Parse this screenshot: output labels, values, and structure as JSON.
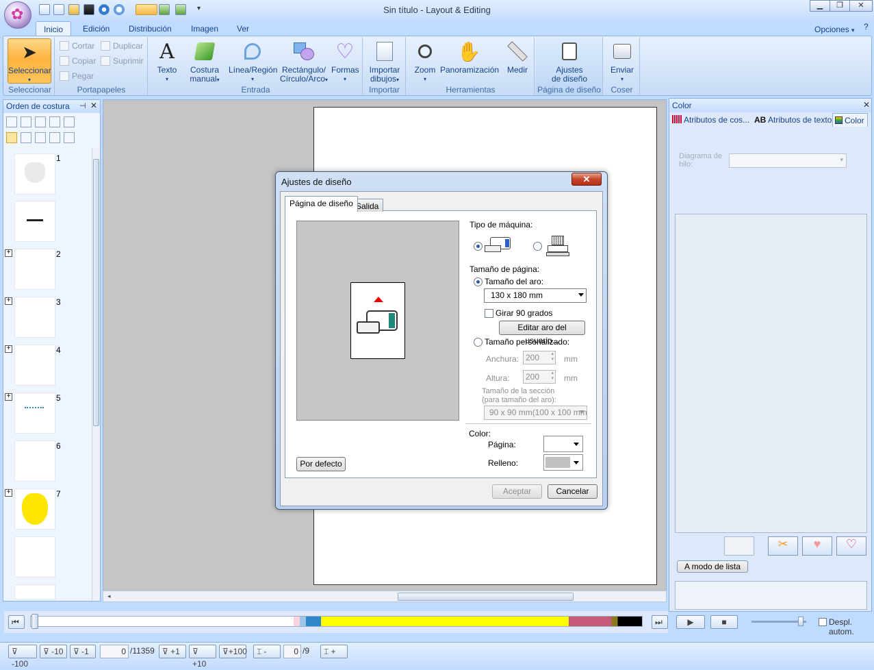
{
  "window": {
    "title": "Sin título - Layout & Editing",
    "minimize": "▁",
    "restore": "❐",
    "close": "✕"
  },
  "ribbon_tabs": [
    "Inicio",
    "Edición",
    "Distribución",
    "Imagen",
    "Ver"
  ],
  "options_label": "Opciones",
  "ribbon": {
    "seleccionar": {
      "label": "Seleccionar",
      "group": "Seleccionar"
    },
    "clipboard": {
      "cortar": "Cortar",
      "copiar": "Copiar",
      "pegar": "Pegar",
      "duplicar": "Duplicar",
      "suprimir": "Suprimir",
      "group": "Portapapeles"
    },
    "entrada": {
      "texto": "Texto",
      "costura_manual_1": "Costura",
      "costura_manual_2": "manual",
      "linea": "Línea/Región",
      "rect_1": "Rectángulo/",
      "rect_2": "Círculo/Arco",
      "formas": "Formas",
      "group": "Entrada"
    },
    "importar": {
      "label_1": "Importar",
      "label_2": "dibujos",
      "group": "Importar"
    },
    "herramientas": {
      "zoom": "Zoom",
      "pan": "Panoramización",
      "medir": "Medir",
      "group": "Herramientas"
    },
    "pagina": {
      "label_1": "Ajustes",
      "label_2": "de diseño",
      "group": "Página de diseño"
    },
    "coser": {
      "label": "Enviar",
      "group": "Coser"
    }
  },
  "left_panel": {
    "title": "Orden de costura",
    "numbers": [
      "1",
      "2",
      "3",
      "4",
      "5",
      "6",
      "7"
    ]
  },
  "right_panel": {
    "title": "Color",
    "tabs": [
      "Atributos de cos...",
      "AB",
      "Atributos de texto",
      "Color"
    ],
    "thread_label_1": "Diagrama de",
    "thread_label_2": "hilo:",
    "list_mode": "A modo de lista",
    "despl": "Despl. autom."
  },
  "status": {
    "m100": "-100",
    "m10": "-10",
    "m1": "-1",
    "stitch_val": "0",
    "stitch_total": "/11359",
    "p1": "+1",
    "p10": "+10",
    "p100": "+100",
    "color_minus": "-",
    "color_val": "0",
    "color_total": "/9",
    "color_plus": "+"
  },
  "dialog": {
    "title": "Ajustes de diseño",
    "close": "✕",
    "tabs": [
      "Página de diseño",
      "Salida"
    ],
    "machine_type": "Tipo de máquina:",
    "page_size": "Tamaño de página:",
    "hoop_size": "Tamaño del aro:",
    "hoop_value": "130 x 180 mm",
    "rotate": "Girar 90 grados",
    "edit_hoop": "Editar aro del usuario...",
    "custom_size": "Tamaño personalizado:",
    "width_label": "Anchura:",
    "width_value": "200",
    "height_label": "Altura:",
    "height_value": "200",
    "unit": "mm",
    "section_1": "Tamaño de la sección",
    "section_2": "(para tamaño del aro):",
    "section_value": "90 x  90 mm(100 x 100 mm",
    "color": "Color:",
    "page_color": "Página:",
    "fill_color": "Relleno:",
    "default_btn": "Por defecto",
    "accept": "Aceptar",
    "cancel": "Cancelar"
  },
  "colors": {
    "accent": "#15428b",
    "timeline_yellow": "#ffff00",
    "timeline_blue": "#2f86c9",
    "timeline_rose": "#c65a79",
    "fill_swatch": "#c0c0c0"
  }
}
